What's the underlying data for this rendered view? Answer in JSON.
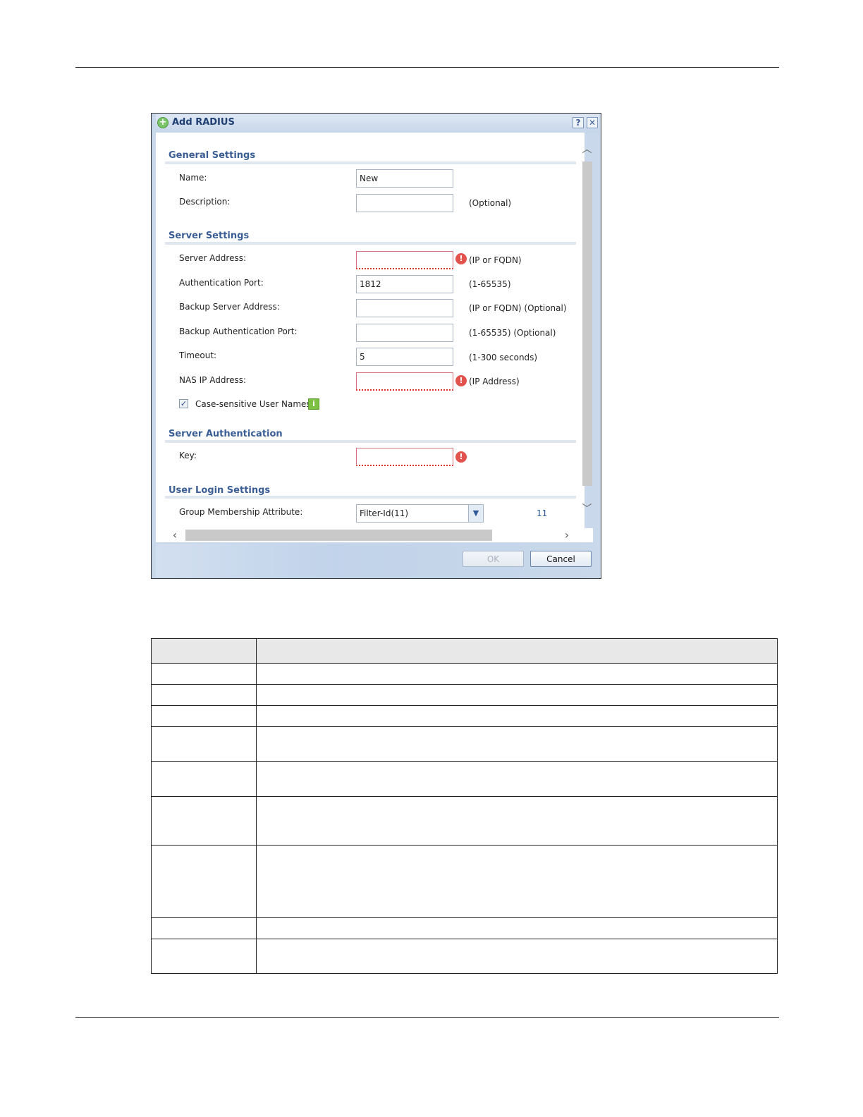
{
  "dialog": {
    "title": "Add RADIUS",
    "help_label": "?",
    "close_label": "✕",
    "general": {
      "title": "General Settings",
      "name_label": "Name:",
      "name_value": "New",
      "description_label": "Description:",
      "description_value": "",
      "description_hint": "(Optional)"
    },
    "server": {
      "title": "Server Settings",
      "server_address_label": "Server Address:",
      "server_address_hint": "(IP or FQDN)",
      "auth_port_label": "Authentication Port:",
      "auth_port_value": "1812",
      "auth_port_hint": "(1-65535)",
      "backup_server_label": "Backup Server Address:",
      "backup_server_hint": "(IP or FQDN) (Optional)",
      "backup_port_label": "Backup Authentication Port:",
      "backup_port_hint": "(1-65535) (Optional)",
      "timeout_label": "Timeout:",
      "timeout_value": "5",
      "timeout_hint": "(1-300 seconds)",
      "nas_ip_label": "NAS IP Address:",
      "nas_ip_hint": "(IP Address)",
      "case_sensitive_label": "Case-sensitive User Names",
      "case_sensitive_checked": true
    },
    "auth": {
      "title": "Server Authentication",
      "key_label": "Key:"
    },
    "login": {
      "title": "User Login Settings",
      "group_attr_label": "Group Membership Attribute:",
      "group_attr_value": "Filter-Id(11)",
      "group_attr_number": "11"
    },
    "buttons": {
      "ok": "OK",
      "cancel": "Cancel"
    }
  },
  "table": {
    "rows": 9
  }
}
